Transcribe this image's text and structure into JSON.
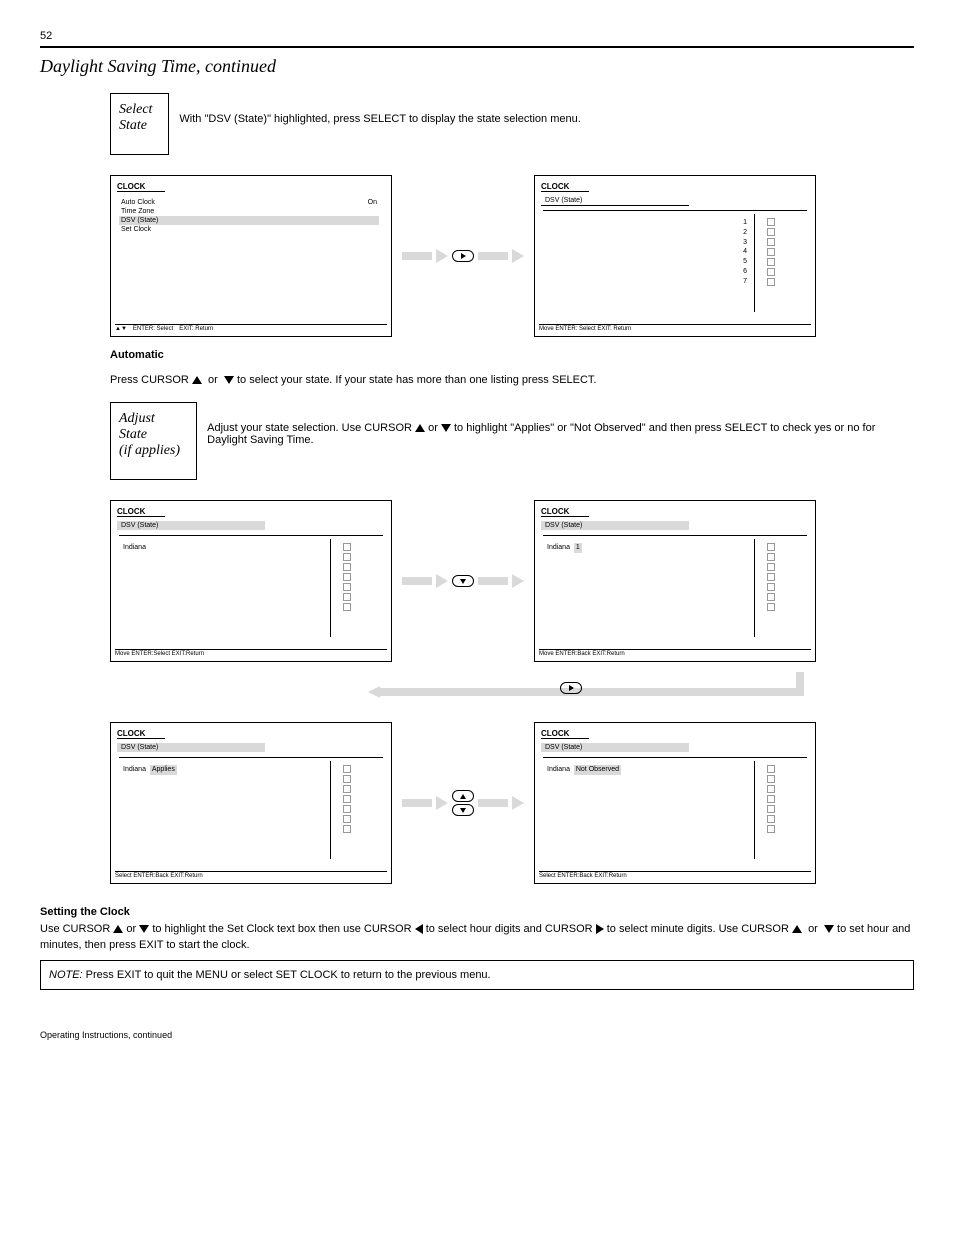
{
  "page_number": "52",
  "section_title": "Daylight Saving Time, continued",
  "select_badge": {
    "line1": "Select",
    "line2": "State",
    "desc": "With \"DSV (State)\" highlighted, press SELECT to display the state selection menu."
  },
  "screen_clock_menu": {
    "tab": "CLOCK",
    "items": [
      {
        "label": "Auto Clock",
        "val": "On",
        "sel": false
      },
      {
        "label": "Time Zone",
        "val": "",
        "sel": false
      },
      {
        "label": "DSV (State)",
        "val": "",
        "sel": true
      },
      {
        "label": "Set Clock",
        "val": "",
        "sel": false
      }
    ],
    "footer_left": "▲▼",
    "footer_mid": "ENTER: Select",
    "footer_right": "EXIT: Return"
  },
  "screen_state_top": {
    "tab": "CLOCK",
    "sub": "DSV (State)",
    "highlight": "",
    "cols": [
      "1",
      "2",
      "3",
      "4",
      "5",
      "6",
      "7"
    ],
    "footer": "Move    ENTER: Select    EXIT: Return"
  },
  "step_auto": {
    "p1_pre": "Press CURSOR ",
    "p1_post": " to select your state. If your state has more than one listing press SELECT."
  },
  "adjust_badge": {
    "line1": "Adjust State",
    "line2": "(if applies)",
    "desc_pre": "Adjust your state selection. Use CURSOR ",
    "desc_mid": " or ",
    "desc_post": " to highlight \"Applies\" or \"Not Observed\" and then press SELECT to check yes or no for Daylight Saving Time."
  },
  "screens_four": {
    "a": {
      "tab": "CLOCK",
      "sub": "DSV (State)",
      "row": "Indiana",
      "footer": "Move    ENTER:Select    EXIT:Return"
    },
    "b": {
      "tab": "CLOCK",
      "sub": "DSV (State)",
      "row": "Indiana",
      "highlight": "1",
      "footer": "Move    ENTER:Back    EXIT:Return"
    },
    "c": {
      "tab": "CLOCK",
      "sub": "DSV (State)",
      "row": "Indiana",
      "highlight": "Applies",
      "footer": "Select    ENTER:Back    EXIT:Return"
    },
    "d": {
      "tab": "CLOCK",
      "sub": "DSV (State)",
      "row": "Indiana",
      "highlight": "Not Observed",
      "footer": "Select    ENTER:Back    EXIT:Return"
    }
  },
  "bottom": {
    "heading": "Setting the Clock",
    "p_pre": "Use CURSOR ",
    "p_mid": " or ",
    "p_mid2": " to highlight the Set Clock text box then use CURSOR ",
    "p_mid3": " to select hour digits and CURSOR ",
    "p_mid4": " to select minute digits. Use CURSOR ",
    "p_post": " to set hour and minutes, then press EXIT to start the clock.",
    "note_pre": "NOTE: ",
    "note": "Press EXIT to quit the MENU or select SET CLOCK to return to the previous menu.",
    "continued": "Operating Instructions, continued"
  }
}
